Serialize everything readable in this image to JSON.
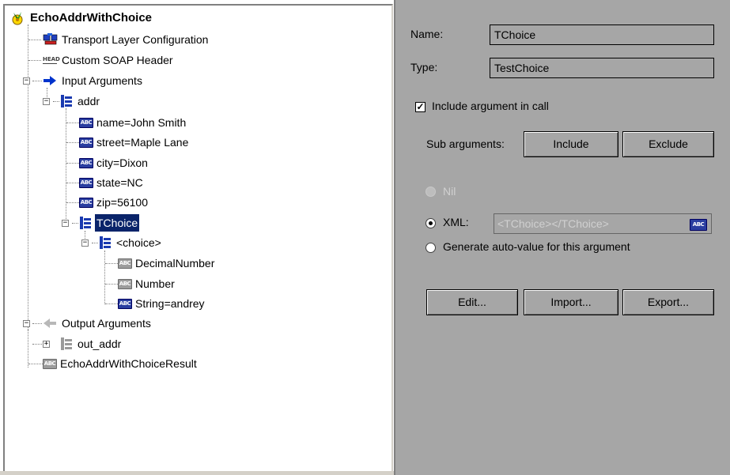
{
  "tree": {
    "root": "EchoAddrWithChoice",
    "transport": "Transport Layer Configuration",
    "soap_header": "Custom SOAP Header",
    "head_icon_text": "HEAD",
    "input_args": "Input Arguments",
    "addr": "addr",
    "addr_fields": [
      "name=John Smith",
      "street=Maple Lane",
      "city=Dixon",
      "state=NC",
      "zip=56100"
    ],
    "tchoice": "TChoice",
    "choice": "<choice>",
    "choice_items": [
      "DecimalNumber",
      "Number",
      "String=andrey"
    ],
    "output_args": "Output Arguments",
    "out_addr": "out_addr",
    "result": "EchoAddrWithChoiceResult",
    "abc_icon_text": "ABC"
  },
  "details": {
    "name_label": "Name:",
    "name_value": "TChoice",
    "type_label": "Type:",
    "type_value": "TestChoice",
    "include_label": "Include argument in call",
    "include_checked": true,
    "sub_args_label": "Sub arguments:",
    "include_btn": "Include",
    "exclude_btn": "Exclude",
    "nil_label": "Nil",
    "xml_label": "XML:",
    "xml_value": "<TChoice></TChoice>",
    "autogen_label": "Generate auto-value for this argument",
    "selected_option": "XML",
    "edit_btn": "Edit...",
    "import_btn": "Import...",
    "export_btn": "Export..."
  },
  "colors": {
    "panel_bg": "#a6a6a6",
    "selection": "#0a246a",
    "arrow_blue": "#0033cc",
    "abc_blue": "#2a3ea0"
  }
}
